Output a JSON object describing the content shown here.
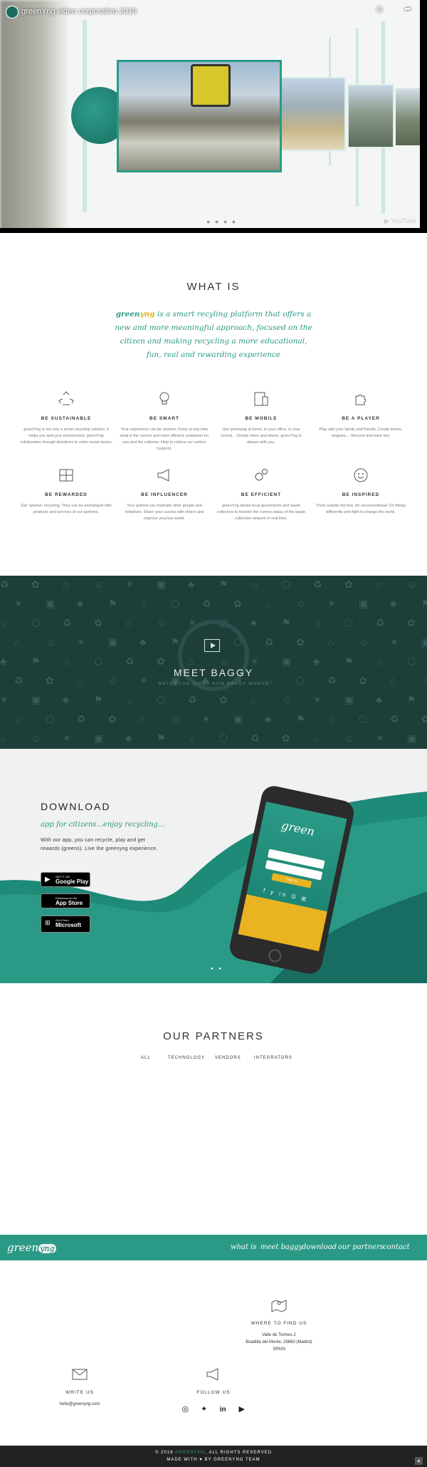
{
  "video": {
    "title": "greenYng video corporativo 2019",
    "watch_later_label": "Ver más tarde",
    "share_label": "Compartir"
  },
  "whatis": {
    "title": "WHAT IS",
    "lead_brand_green": "green",
    "lead_brand_yellow": "yng",
    "lead_text": " is a smart recyling platform that offers a new and more meaningful approach, focused on the citizen and making recycling a more educational, fun, real and rewarding experience",
    "features": [
      {
        "icon": "recycle-icon",
        "title": "BE SUSTAINABLE",
        "text": "greenYng is not only a smart recycling solution, it helps you and your environment. greenYng collaborates through donations to solve social issues."
      },
      {
        "icon": "lightbulb-icon",
        "title": "BE SMART",
        "text": "Your experience can be smarter. Know at any time what is the correct and more efficient containers for you and the collector. Help to reduce our carbon footprint."
      },
      {
        "icon": "mobile-icon",
        "title": "BE MOBILE",
        "text": "Use greenyng at home, in your office, in your school... Decide when and where. greenYng is always with you."
      },
      {
        "icon": "puzzle-icon",
        "title": "BE A PLAYER",
        "text": "Play with your family and friends. Create teams, leagues,... Recycle and have fun!"
      },
      {
        "icon": "reward-icon",
        "title": "BE REWARDED",
        "text": "Get \"greens\" recycling. They can be exchanged with products and services of our partners."
      },
      {
        "icon": "megaphone-icon",
        "title": "BE INFLUENCER",
        "text": "Your actions can motivate other people and initiatives. Share your sucess with others and improve your/our world."
      },
      {
        "icon": "gears-icon",
        "title": "BE EFFICIENT",
        "text": "greenYng allows local goverments and waste collectors to monitor the current status of the waste collection network in real time."
      },
      {
        "icon": "smile-icon",
        "title": "BE INSPIRED",
        "text": "Think outside the box, be unconventional. Do things differently and fight to change the world."
      }
    ]
  },
  "baggy": {
    "title": "MEET BAGGY",
    "subtitle": "WATCH THE VIDEO HOW BAGGY WORKS"
  },
  "download": {
    "title": "DOWNLOAD",
    "subtitle": "app for citizens...enjoy recycling...",
    "text": "With our app, you can recycle, play and get rewards (greens). Live the greenyng experience.",
    "stores": [
      {
        "icon": "google-play-icon",
        "small": "GET IT ON",
        "big": "Google Play"
      },
      {
        "icon": "apple-icon",
        "small": "Download on the",
        "big": "App Store"
      },
      {
        "icon": "microsoft-icon",
        "small": "Get it from",
        "big": "Microsoft"
      }
    ],
    "phone": {
      "logo": "green",
      "signin": "Sign in",
      "social": "f y in G ⊞"
    },
    "colors": {
      "teal": "#2a9a86",
      "yellow": "#e9b321"
    }
  },
  "partners": {
    "title": "OUR PARTNERS",
    "tabs": [
      "ALL",
      "TECHNOLOGY",
      "VENDORS",
      "INTEGRATORS"
    ]
  },
  "footer_nav": {
    "logo_text": "green",
    "logo_badge": "yng",
    "items": [
      "what is",
      "meet baggy",
      "download",
      "our partners",
      "contact"
    ]
  },
  "contact": {
    "find": {
      "title": "WHERE TO FIND US",
      "lines": [
        "Valle de Tormes 2",
        "Boadilla del Monte, 28660 (Madrid)",
        "SPAIN"
      ]
    },
    "write": {
      "title": "WRITE US",
      "email": "hello@greenyng.com"
    },
    "follow": {
      "title": "FOLLOW US",
      "networks": [
        "instagram",
        "twitter",
        "linkedin",
        "youtube"
      ]
    }
  },
  "copyright": {
    "line1_prefix": "© 2018 ",
    "line1_brand": "GREENYNG",
    "line1_suffix": ", ALL RIGHTS RESERVED",
    "line2": "MADE WITH ♥ BY GREENYNG TEAM"
  }
}
